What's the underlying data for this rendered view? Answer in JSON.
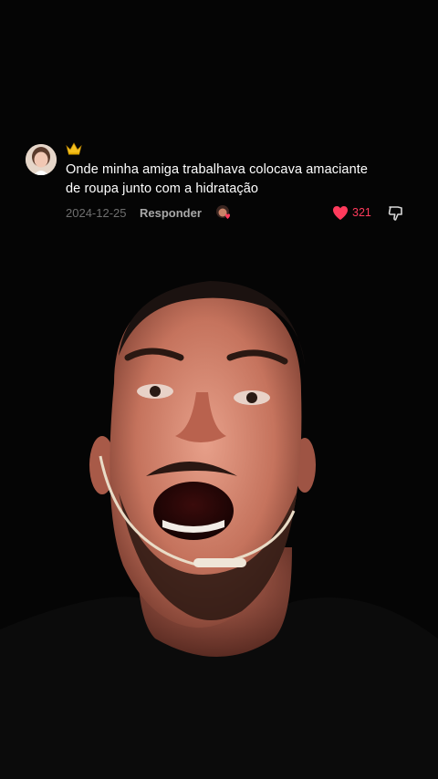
{
  "comment": {
    "text_line1": "Onde minha amiga trabalhava colocava amaciante",
    "text_line2": "de roupa junto com a hidratação",
    "date": "2024-12-25",
    "reply_label": "Responder",
    "like_count": "321",
    "icons": {
      "avatar": "user-avatar",
      "crown": "crown-icon",
      "creator": "creator-liked-avatar",
      "like": "heart-icon",
      "dislike": "thumbs-down-icon"
    }
  },
  "colors": {
    "background": "#050505",
    "like_accent": "#ff3b5c",
    "crown": "#f4c01e"
  }
}
